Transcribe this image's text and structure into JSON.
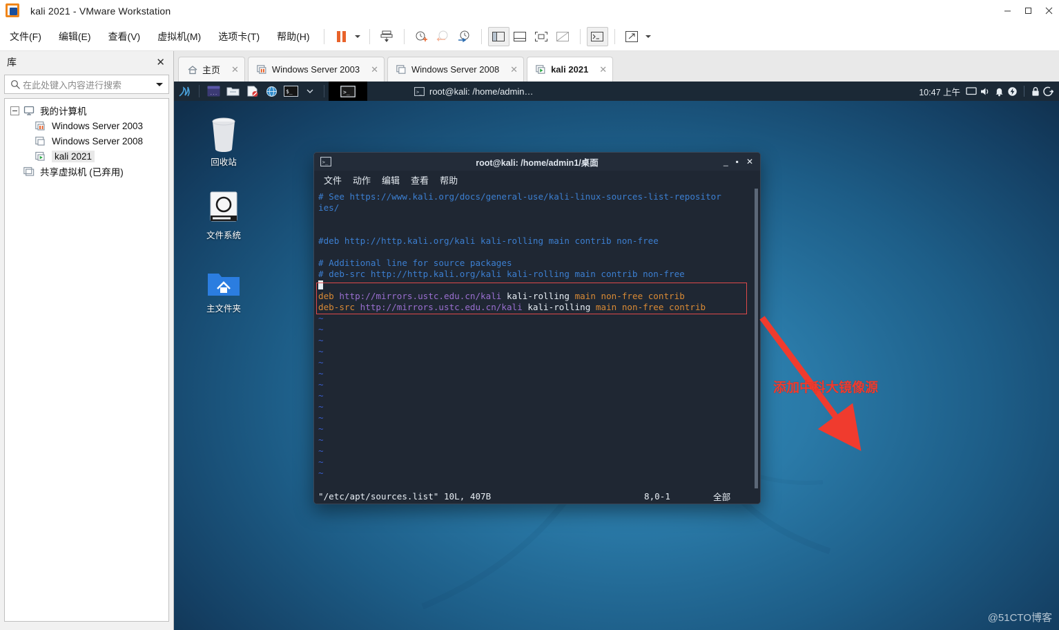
{
  "window": {
    "title": "kali 2021 - VMware Workstation",
    "controls": {
      "minimize": "minimize-icon",
      "maximize": "maximize-icon",
      "close": "close-icon"
    }
  },
  "menubar": {
    "items": [
      "文件(F)",
      "编辑(E)",
      "查看(V)",
      "虚拟机(M)",
      "选项卡(T)",
      "帮助(H)"
    ],
    "toolbar_icons": [
      "pause-icon",
      "dropdown-caret-icon",
      "send-ctrl-alt-del-icon",
      "snapshot-take-icon",
      "snapshot-revert-icon",
      "snapshot-manager-icon",
      "show-library-icon",
      "show-thumbnails-icon",
      "full-screen-icon",
      "unity-mode-icon",
      "console-view-icon",
      "stretch-guest-icon",
      "view-dropdown-caret-icon"
    ]
  },
  "library": {
    "title": "库",
    "close_label": "✕",
    "search": {
      "placeholder": "在此处键入内容进行搜索",
      "value": ""
    },
    "tree": [
      {
        "label": "我的计算机",
        "level": 0,
        "icon": "computer-icon",
        "expanded": true,
        "selected": false
      },
      {
        "label": "Windows Server 2003",
        "level": 1,
        "icon": "vm-suspended-icon",
        "selected": false
      },
      {
        "label": "Windows Server 2008",
        "level": 1,
        "icon": "vm-powered-off-icon",
        "selected": false
      },
      {
        "label": "kali 2021",
        "level": 1,
        "icon": "vm-running-icon",
        "selected": true
      },
      {
        "label": "共享虚拟机 (已弃用)",
        "level": 0,
        "icon": "shared-vm-icon",
        "selected": false
      }
    ]
  },
  "tabs": [
    {
      "label": "主页",
      "icon": "home-icon",
      "active": false,
      "close": "✕"
    },
    {
      "label": "Windows Server 2003",
      "icon": "vm-suspended-icon",
      "active": false,
      "close": "✕"
    },
    {
      "label": "Windows Server 2008",
      "icon": "vm-powered-off-icon",
      "active": false,
      "close": "✕"
    },
    {
      "label": "kali 2021",
      "icon": "vm-running-icon",
      "active": true,
      "close": "✕"
    }
  ],
  "guest": {
    "taskbar": {
      "logo": "kali-dragon-icon",
      "launchers": [
        "terminal-emulator-icon",
        "file-manager-icon",
        "text-editor-icon",
        "web-browser-icon",
        "root-terminal-icon"
      ],
      "launcher_caret": "chevron-down-icon",
      "active_window_icon": "terminal-window-icon",
      "task_title": "root@kali: /home/admin…",
      "task_icon": "terminal-icon",
      "clock": "10:47 上午",
      "tray_icons": [
        "display-icon",
        "volume-icon",
        "notification-bell-icon",
        "power-manager-icon",
        "lock-screen-icon",
        "logout-icon"
      ]
    },
    "desktop_icons": [
      {
        "label": "回收站",
        "icon": "trash-icon"
      },
      {
        "label": "文件系统",
        "icon": "filesystem-drive-icon"
      },
      {
        "label": "主文件夹",
        "icon": "home-folder-icon"
      }
    ],
    "annotation": {
      "text": "添加中科大镜像源",
      "color": "#f03b2e",
      "arrow": "red-arrow"
    },
    "watermark": "@51CTO博客"
  },
  "terminal": {
    "title": "root@kali: /home/admin1/桌面",
    "title_icon": "terminal-icon",
    "controls": {
      "minimize": "_",
      "maximize": "▪",
      "close": "✕"
    },
    "menu": [
      "文件",
      "动作",
      "编辑",
      "查看",
      "帮助"
    ],
    "lines": [
      {
        "type": "comment",
        "text": "# See https://www.kali.org/docs/general-use/kali-linux-sources-list-repositor"
      },
      {
        "type": "comment",
        "text": "ies/"
      },
      {
        "type": "blank",
        "text": ""
      },
      {
        "type": "blank",
        "text": ""
      },
      {
        "type": "comment",
        "text": "#deb http://http.kali.org/kali kali-rolling main contrib non-free"
      },
      {
        "type": "blank",
        "text": ""
      },
      {
        "type": "comment",
        "text": "# Additional line for source packages"
      },
      {
        "type": "comment",
        "text": "# deb-src http://http.kali.org/kali kali-rolling main contrib non-free"
      },
      {
        "type": "cursor",
        "text": ""
      },
      {
        "type": "src",
        "kw": "deb",
        "url": "http://mirrors.ustc.edu.cn/kali",
        "suite": "kali-rolling",
        "comps": "main non-free contrib"
      },
      {
        "type": "src",
        "kw": "deb-src",
        "url": "http://mirrors.ustc.edu.cn/kali",
        "suite": "kali-rolling",
        "comps": "main non-free contrib"
      },
      {
        "type": "tilde",
        "text": "~"
      },
      {
        "type": "tilde",
        "text": "~"
      },
      {
        "type": "tilde",
        "text": "~"
      },
      {
        "type": "tilde",
        "text": "~"
      },
      {
        "type": "tilde",
        "text": "~"
      },
      {
        "type": "tilde",
        "text": "~"
      },
      {
        "type": "tilde",
        "text": "~"
      },
      {
        "type": "tilde",
        "text": "~"
      },
      {
        "type": "tilde",
        "text": "~"
      },
      {
        "type": "tilde",
        "text": "~"
      },
      {
        "type": "tilde",
        "text": "~"
      },
      {
        "type": "tilde",
        "text": "~"
      },
      {
        "type": "tilde",
        "text": "~"
      },
      {
        "type": "tilde",
        "text": "~"
      },
      {
        "type": "tilde",
        "text": "~"
      }
    ],
    "status": {
      "file": "\"/etc/apt/sources.list\" 10L, 407B",
      "position": "8,0-1",
      "scroll": "全部"
    }
  },
  "colors": {
    "accent_orange": "#e8622a",
    "kali_blue": "#2f88b8",
    "annotation_red": "#f03b2e",
    "terminal_bg": "#1f2733"
  }
}
